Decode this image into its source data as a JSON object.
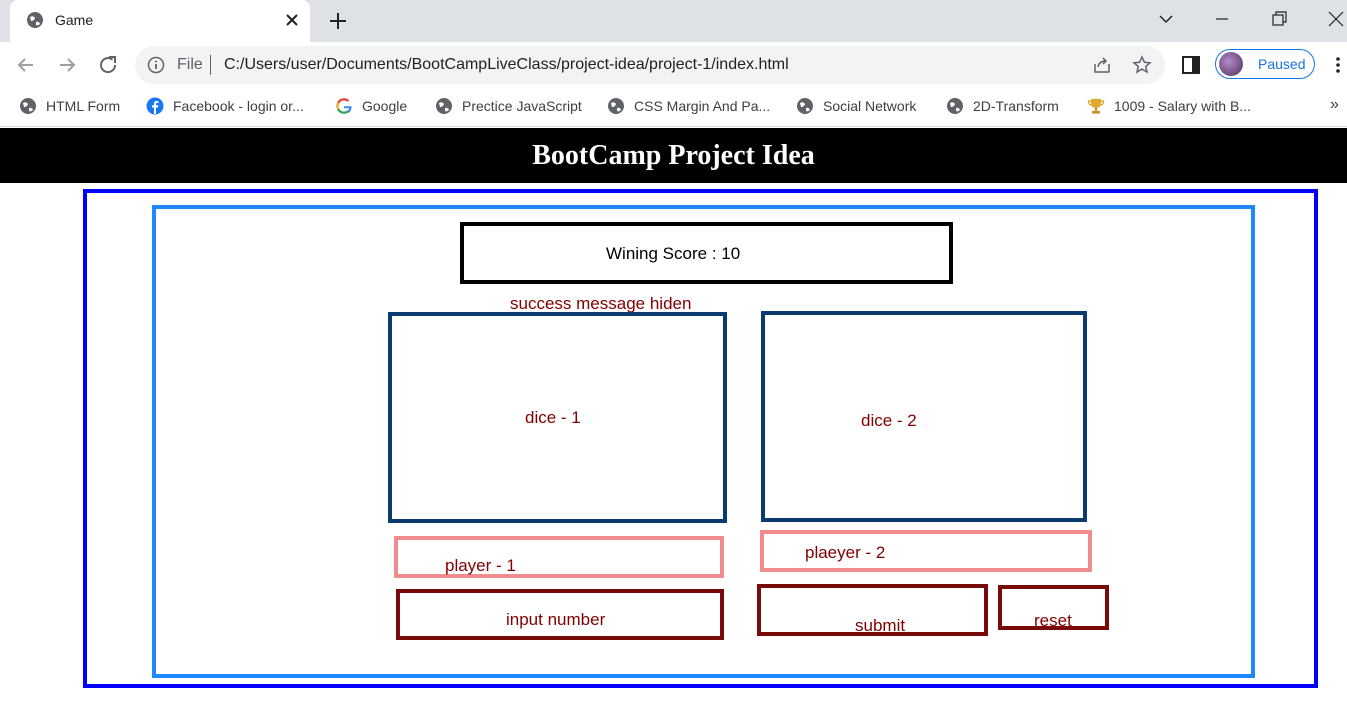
{
  "browser": {
    "tab": {
      "title": "Game"
    },
    "address_bar": {
      "scheme_label": "File",
      "url": "C:/Users/user/Documents/BootCampLiveClass/project-idea/project-1/index.html"
    },
    "profile": {
      "label": "Paused"
    },
    "bookmarks": [
      {
        "label": "HTML Form",
        "icon": "globe-icon"
      },
      {
        "label": "Facebook - login or...",
        "icon": "facebook-icon"
      },
      {
        "label": "Google",
        "icon": "google-icon"
      },
      {
        "label": "Prectice JavaScript",
        "icon": "globe-icon"
      },
      {
        "label": "CSS Margin And Pa...",
        "icon": "globe-icon"
      },
      {
        "label": "Social Network",
        "icon": "globe-icon"
      },
      {
        "label": "2D-Transform",
        "icon": "globe-icon"
      },
      {
        "label": "1009 - Salary with B...",
        "icon": "trophy-icon"
      }
    ],
    "bookmarks_overflow": "»"
  },
  "page": {
    "header": "BootCamp Project Idea",
    "winning_score": "Wining Score : 10",
    "success_message": "success message hiden",
    "dice": [
      "dice - 1",
      "dice - 2"
    ],
    "players": [
      "player - 1",
      "plaeyer - 2"
    ],
    "input_placeholder": "input number",
    "submit_label": "submit",
    "reset_label": "reset"
  },
  "colors": {
    "outer_frame": "#0000ff",
    "inner_frame": "#1e88ff",
    "dice_border": "#0a3a6e",
    "player_border": "#f08c8c",
    "control_border": "#7a0a0a",
    "label_text": "#800000",
    "header_bg": "#000000"
  }
}
